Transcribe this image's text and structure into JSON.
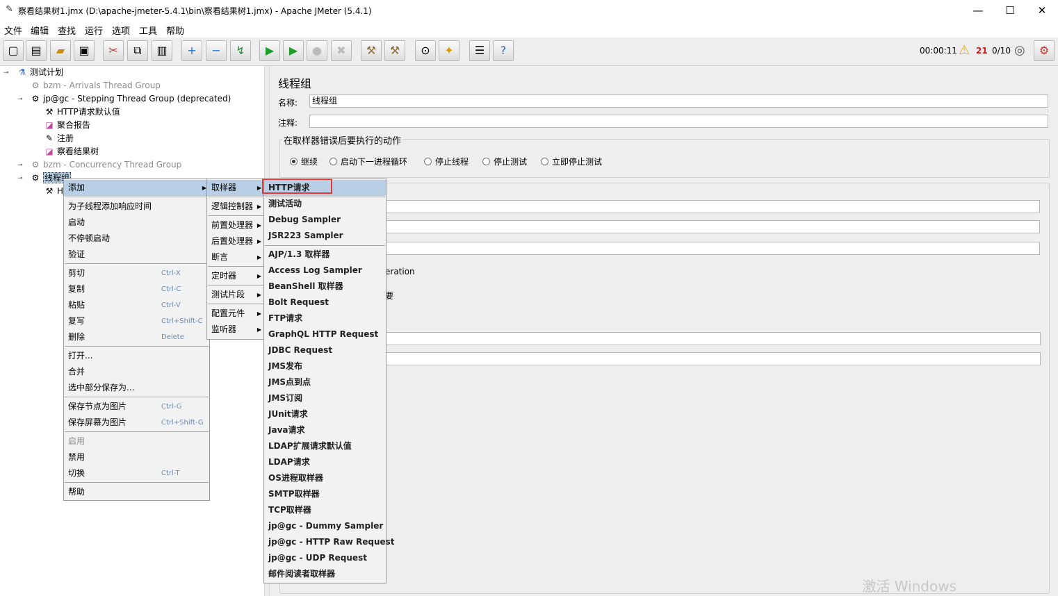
{
  "window": {
    "title": "察看结果树1.jmx (D:\\apache-jmeter-5.4.1\\bin\\察看结果树1.jmx) - Apache JMeter (5.4.1)",
    "minimize": "—",
    "maximize": "☐",
    "close": "✕"
  },
  "menubar": [
    "文件",
    "编辑",
    "查找",
    "运行",
    "选项",
    "工具",
    "帮助"
  ],
  "toolbar": {
    "buttons": [
      "new-icon",
      "templates-icon",
      "open-icon",
      "save-icon",
      "cut-icon",
      "copy-icon",
      "paste-icon",
      "expand-icon",
      "collapse-icon",
      "toggle-icon",
      "start-icon",
      "start-no-pause-icon",
      "stop-icon",
      "shutdown-icon",
      "clear-icon",
      "clear-all-icon",
      "search-icon",
      "reset-search-icon",
      "function-helper-icon",
      "help-icon"
    ],
    "elapsed": "00:00:11",
    "warning_count": "21",
    "threads": "0/10"
  },
  "tree": {
    "nodes": [
      {
        "label": "测试计划"
      },
      {
        "label": "bzm - Arrivals Thread Group"
      },
      {
        "label": "jp@gc - Stepping Thread Group (deprecated)"
      },
      {
        "label": "HTTP请求默认值"
      },
      {
        "label": "聚合报告"
      },
      {
        "label": "注册"
      },
      {
        "label": "察看结果树"
      },
      {
        "label": "bzm - Concurrency Thread Group"
      },
      {
        "label": "线程组"
      },
      {
        "label": "H"
      }
    ]
  },
  "panel": {
    "title": "线程组",
    "name_label": "名称:",
    "name_value": "线程组",
    "comment_label": "注释:",
    "comment_value": "",
    "error_action_title": "在取样器错误后要执行的动作",
    "error_actions": [
      "继续",
      "启动下一进程循环",
      "停止线程",
      "停止测试",
      "立即停止测试"
    ],
    "partial_text_1": "eration",
    "partial_text_2": "要"
  },
  "context_menu": {
    "items": [
      "添加",
      "为子线程添加响应时间",
      "启动",
      "不停顿启动",
      "验证",
      "剪切",
      "复制",
      "粘贴",
      "复写",
      "删除",
      "打开...",
      "合并",
      "选中部分保存为...",
      "保存节点为图片",
      "保存屏幕为图片",
      "启用",
      "禁用",
      "切换",
      "帮助"
    ],
    "accelerators": {
      "cut": "Ctrl-X",
      "copy": "Ctrl-C",
      "paste": "Ctrl-V",
      "duplicate": "Ctrl+Shift-C",
      "delete": "Delete",
      "save_node_image": "Ctrl-G",
      "save_screen_image": "Ctrl+Shift-G",
      "toggle": "Ctrl-T"
    }
  },
  "add_submenu": [
    "取样器",
    "逻辑控制器",
    "前置处理器",
    "后置处理器",
    "断言",
    "定时器",
    "测试片段",
    "配置元件",
    "监听器"
  ],
  "sampler_submenu": [
    "HTTP请求",
    "测试活动",
    "Debug Sampler",
    "JSR223 Sampler",
    "AJP/1.3 取样器",
    "Access Log Sampler",
    "BeanShell 取样器",
    "Bolt Request",
    "FTP请求",
    "GraphQL HTTP Request",
    "JDBC Request",
    "JMS发布",
    "JMS点到点",
    "JMS订阅",
    "JUnit请求",
    "Java请求",
    "LDAP扩展请求默认值",
    "LDAP请求",
    "OS进程取样器",
    "SMTP取样器",
    "TCP取样器",
    "jp@gc - Dummy Sampler",
    "jp@gc - HTTP Raw Request",
    "jp@gc - UDP Request",
    "邮件阅读者取样器"
  ],
  "watermark": "激活 Windows",
  "colors": {
    "highlight": "#b8cfe5",
    "red_box": "#e53935",
    "warning": "#d11a1a"
  }
}
